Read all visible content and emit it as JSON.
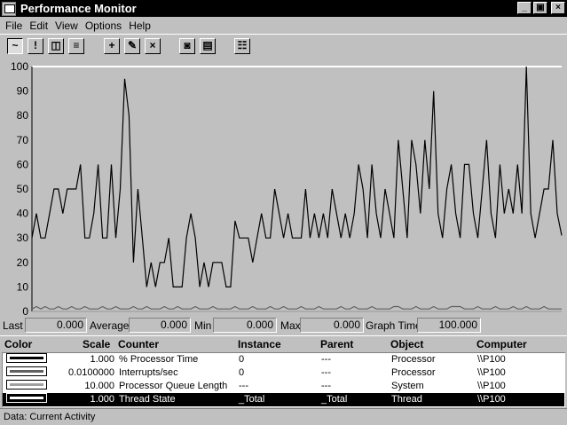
{
  "window": {
    "title": "Performance Monitor",
    "buttons": [
      "_",
      "▣",
      "×"
    ]
  },
  "menu": [
    "File",
    "Edit",
    "View",
    "Options",
    "Help"
  ],
  "toolbar": [
    {
      "name": "chart-view-icon",
      "glyph": "~"
    },
    {
      "name": "alert-view-icon",
      "glyph": "!"
    },
    {
      "name": "log-view-icon",
      "glyph": "◫"
    },
    {
      "name": "report-view-icon",
      "glyph": "≡"
    },
    {
      "name": "add-counter-icon",
      "glyph": "+"
    },
    {
      "name": "edit-counter-icon",
      "glyph": "✎"
    },
    {
      "name": "delete-counter-icon",
      "glyph": "×"
    },
    {
      "name": "update-now-icon",
      "glyph": "◙"
    },
    {
      "name": "bookmark-icon",
      "glyph": "▤"
    },
    {
      "name": "options-icon",
      "glyph": "☷"
    }
  ],
  "chart_data": {
    "type": "line",
    "ylim": [
      0,
      100
    ],
    "yticks": [
      "100",
      "90",
      "80",
      "70",
      "60",
      "50",
      "40",
      "30",
      "20",
      "10",
      "0"
    ],
    "series": [
      {
        "name": "% Processor Time",
        "color": "#000000",
        "values": [
          30,
          40,
          30,
          30,
          40,
          50,
          50,
          40,
          50,
          50,
          50,
          60,
          30,
          30,
          40,
          60,
          30,
          30,
          60,
          30,
          50,
          95,
          80,
          20,
          50,
          30,
          10,
          20,
          10,
          20,
          20,
          30,
          10,
          10,
          10,
          30,
          40,
          30,
          10,
          20,
          10,
          20,
          20,
          20,
          10,
          10,
          37,
          30,
          30,
          30,
          20,
          30,
          40,
          30,
          30,
          50,
          40,
          30,
          40,
          30,
          30,
          30,
          50,
          30,
          40,
          30,
          40,
          30,
          50,
          40,
          30,
          40,
          30,
          40,
          60,
          50,
          30,
          60,
          40,
          30,
          50,
          40,
          30,
          70,
          50,
          30,
          70,
          60,
          40,
          70,
          50,
          90,
          40,
          30,
          50,
          60,
          40,
          30,
          60,
          60,
          40,
          30,
          50,
          70,
          40,
          30,
          60,
          40,
          50,
          40,
          60,
          40,
          100,
          40,
          30,
          40,
          50,
          50,
          70,
          40,
          31
        ]
      },
      {
        "name": "Interrupts/sec",
        "color": "#606060",
        "values": [
          1,
          2,
          1,
          2,
          1,
          1,
          2,
          1,
          1,
          2,
          1,
          1,
          2,
          1,
          1,
          1,
          2,
          1,
          1,
          2,
          1,
          1,
          1,
          2,
          1,
          1,
          2,
          1,
          1,
          1,
          2,
          1,
          1,
          2,
          1,
          1,
          1,
          2,
          1,
          1,
          1,
          2,
          1,
          1,
          1,
          1,
          2,
          1,
          1,
          1,
          2,
          1,
          1,
          1,
          2,
          1,
          1,
          2,
          1,
          1,
          1,
          2,
          1,
          1,
          1,
          2,
          1,
          1,
          1,
          1,
          2,
          1,
          1,
          2,
          1,
          1,
          1,
          2,
          1,
          1,
          1,
          1,
          2,
          2,
          1,
          1,
          1,
          2,
          1,
          1,
          1,
          2,
          1,
          1,
          1,
          2,
          2,
          2,
          1,
          1,
          1,
          2,
          1,
          1,
          1,
          2,
          1,
          1,
          1,
          2,
          1,
          1,
          2,
          1,
          1,
          1,
          2,
          1,
          1,
          1,
          1
        ]
      },
      {
        "name": "Processor Queue Length",
        "color": "#a0a0a0",
        "values": [
          0,
          0,
          0,
          0,
          0,
          0,
          0,
          0,
          0,
          0,
          0,
          0,
          0,
          0,
          0,
          0,
          0,
          0,
          0,
          0,
          0,
          0,
          0,
          0,
          0,
          0,
          0,
          0,
          0,
          0,
          0,
          0,
          0,
          0,
          0,
          0,
          0,
          0,
          0,
          0,
          0,
          0,
          0,
          0,
          0,
          0,
          0,
          0,
          0,
          0,
          0,
          0,
          0,
          0,
          0,
          0,
          0,
          0,
          0,
          0,
          0,
          0,
          0,
          0,
          0,
          0,
          0,
          0,
          0,
          0,
          0,
          0,
          0,
          0,
          0,
          0,
          0,
          0,
          0,
          0,
          0,
          0,
          0,
          0,
          0,
          0,
          0,
          0,
          0,
          0,
          0,
          0,
          0,
          0,
          0,
          0,
          0,
          0,
          0,
          0,
          0,
          0,
          0,
          0,
          0,
          0,
          0,
          0,
          0,
          0,
          0,
          0,
          0,
          0,
          0,
          0,
          0,
          0,
          0,
          0,
          0
        ]
      }
    ]
  },
  "values": {
    "last_label": "Last",
    "last": "0.000",
    "average_label": "Average",
    "average": "0.000",
    "min_label": "Min",
    "min": "0.000",
    "max_label": "Max",
    "max": "0.000",
    "graph_time_label": "Graph Time",
    "graph_time": "100.000"
  },
  "legend": {
    "headers": {
      "color": "Color",
      "scale": "Scale",
      "counter": "Counter",
      "instance": "Instance",
      "parent": "Parent",
      "object": "Object",
      "computer": "Computer"
    },
    "rows": [
      {
        "scale": "1.000",
        "counter": "% Processor Time",
        "instance": "0",
        "parent": "---",
        "object": "Processor",
        "computer": "\\\\P100",
        "color": "#000000",
        "selected": false
      },
      {
        "scale": "0.0100000",
        "counter": "Interrupts/sec",
        "instance": "0",
        "parent": "---",
        "object": "Processor",
        "computer": "\\\\P100",
        "color": "#606060",
        "selected": false
      },
      {
        "scale": "10.000",
        "counter": "Processor Queue Length",
        "instance": "---",
        "parent": "---",
        "object": "System",
        "computer": "\\\\P100",
        "color": "#a0a0a0",
        "selected": false
      },
      {
        "scale": "1.000",
        "counter": "Thread State",
        "instance": "_Total",
        "parent": "_Total",
        "object": "Thread",
        "computer": "\\\\P100",
        "color": "#ffffff",
        "selected": true
      }
    ]
  },
  "status": {
    "text": "Data: Current Activity"
  }
}
